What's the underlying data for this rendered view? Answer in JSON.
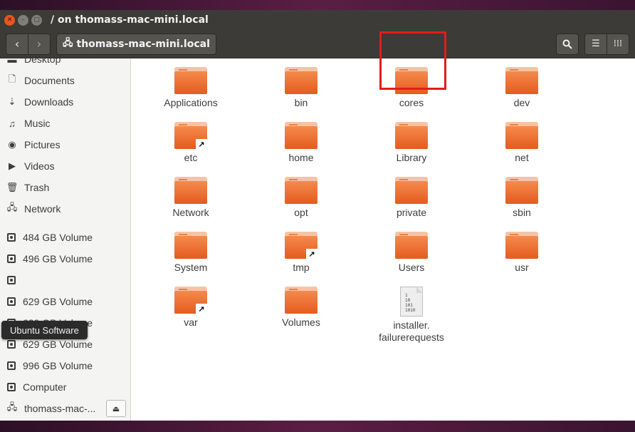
{
  "window": {
    "title": "/ on thomass-mac-mini.local"
  },
  "toolbar": {
    "path_label": "thomass-mac-mini.local"
  },
  "sidebar": {
    "items": [
      {
        "label": "Desktop",
        "icon": "desktop-icon"
      },
      {
        "label": "Documents",
        "icon": "document-icon"
      },
      {
        "label": "Downloads",
        "icon": "download-icon"
      },
      {
        "label": "Music",
        "icon": "music-icon"
      },
      {
        "label": "Pictures",
        "icon": "camera-icon"
      },
      {
        "label": "Videos",
        "icon": "video-icon"
      },
      {
        "label": "Trash",
        "icon": "trash-icon"
      },
      {
        "label": "Network",
        "icon": "network-icon"
      },
      {
        "label": "484 GB Volume",
        "icon": "drive-icon"
      },
      {
        "label": "496 GB Volume",
        "icon": "drive-icon"
      },
      {
        "label": "",
        "icon": "drive-icon"
      },
      {
        "label": "629 GB Volume",
        "icon": "drive-icon"
      },
      {
        "label": "629 GB Volume",
        "icon": "drive-icon"
      },
      {
        "label": "629 GB Volume",
        "icon": "drive-icon"
      },
      {
        "label": "996 GB Volume",
        "icon": "drive-icon"
      },
      {
        "label": "Computer",
        "icon": "drive-icon"
      },
      {
        "label": "thomass-mac-...",
        "icon": "network-share-icon"
      }
    ],
    "tooltip": "Ubuntu Software"
  },
  "files": [
    {
      "name": "Applications",
      "type": "folder"
    },
    {
      "name": "bin",
      "type": "folder"
    },
    {
      "name": "cores",
      "type": "folder"
    },
    {
      "name": "dev",
      "type": "folder"
    },
    {
      "name": "etc",
      "type": "folder-link"
    },
    {
      "name": "home",
      "type": "folder"
    },
    {
      "name": "Library",
      "type": "folder"
    },
    {
      "name": "net",
      "type": "folder"
    },
    {
      "name": "Network",
      "type": "folder"
    },
    {
      "name": "opt",
      "type": "folder"
    },
    {
      "name": "private",
      "type": "folder"
    },
    {
      "name": "sbin",
      "type": "folder"
    },
    {
      "name": "System",
      "type": "folder"
    },
    {
      "name": "tmp",
      "type": "folder-link"
    },
    {
      "name": "Users",
      "type": "folder"
    },
    {
      "name": "usr",
      "type": "folder"
    },
    {
      "name": "var",
      "type": "folder-link"
    },
    {
      "name": "Volumes",
      "type": "folder"
    },
    {
      "name": "installer.\nfailurerequests",
      "type": "binary-file"
    }
  ],
  "binary_icon_text": "1\n10\n101\n1010",
  "highlight_color": "#e31b1b",
  "accent_color": "#e95420"
}
